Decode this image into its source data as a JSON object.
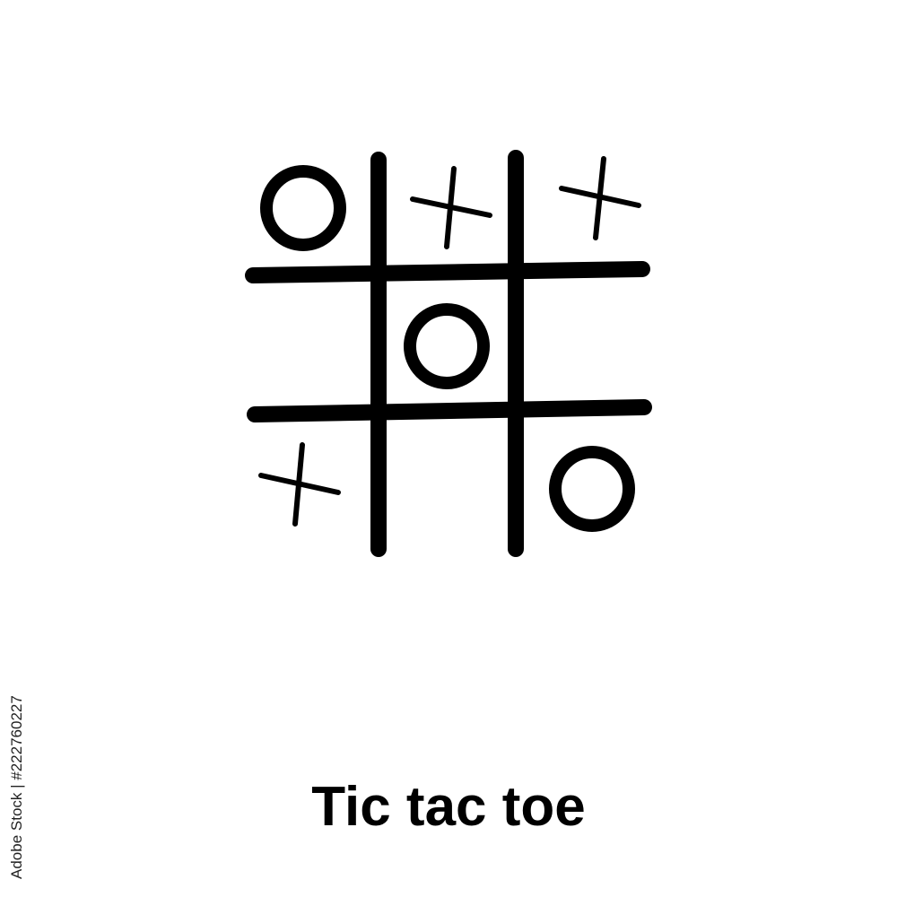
{
  "caption": "Tic tac toe",
  "stock_id": "Adobe Stock | #222760227",
  "colors": {
    "background": "#ffffff",
    "ink": "#000000"
  },
  "board": {
    "rows": [
      [
        "O",
        "X",
        "X"
      ],
      [
        "",
        "O",
        ""
      ],
      [
        "X",
        "",
        "O"
      ]
    ]
  }
}
